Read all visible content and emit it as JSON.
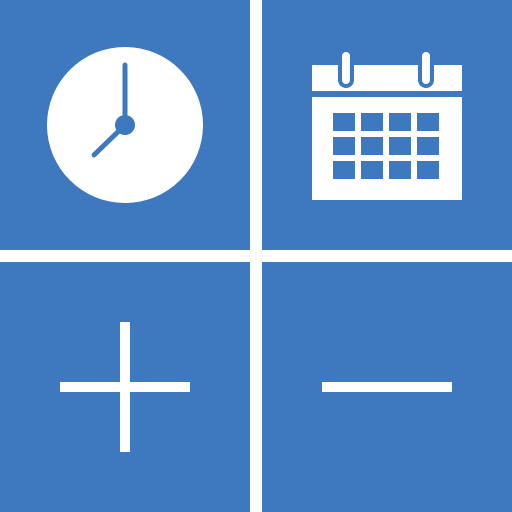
{
  "app": {
    "tiles": [
      {
        "id": "clock",
        "icon": "clock-icon"
      },
      {
        "id": "calendar",
        "icon": "calendar-icon"
      },
      {
        "id": "add",
        "icon": "plus-icon"
      },
      {
        "id": "subtract",
        "icon": "minus-icon"
      }
    ]
  },
  "colors": {
    "tile_background": "#3e79bf",
    "icon": "#ffffff",
    "divider": "#ffffff"
  }
}
